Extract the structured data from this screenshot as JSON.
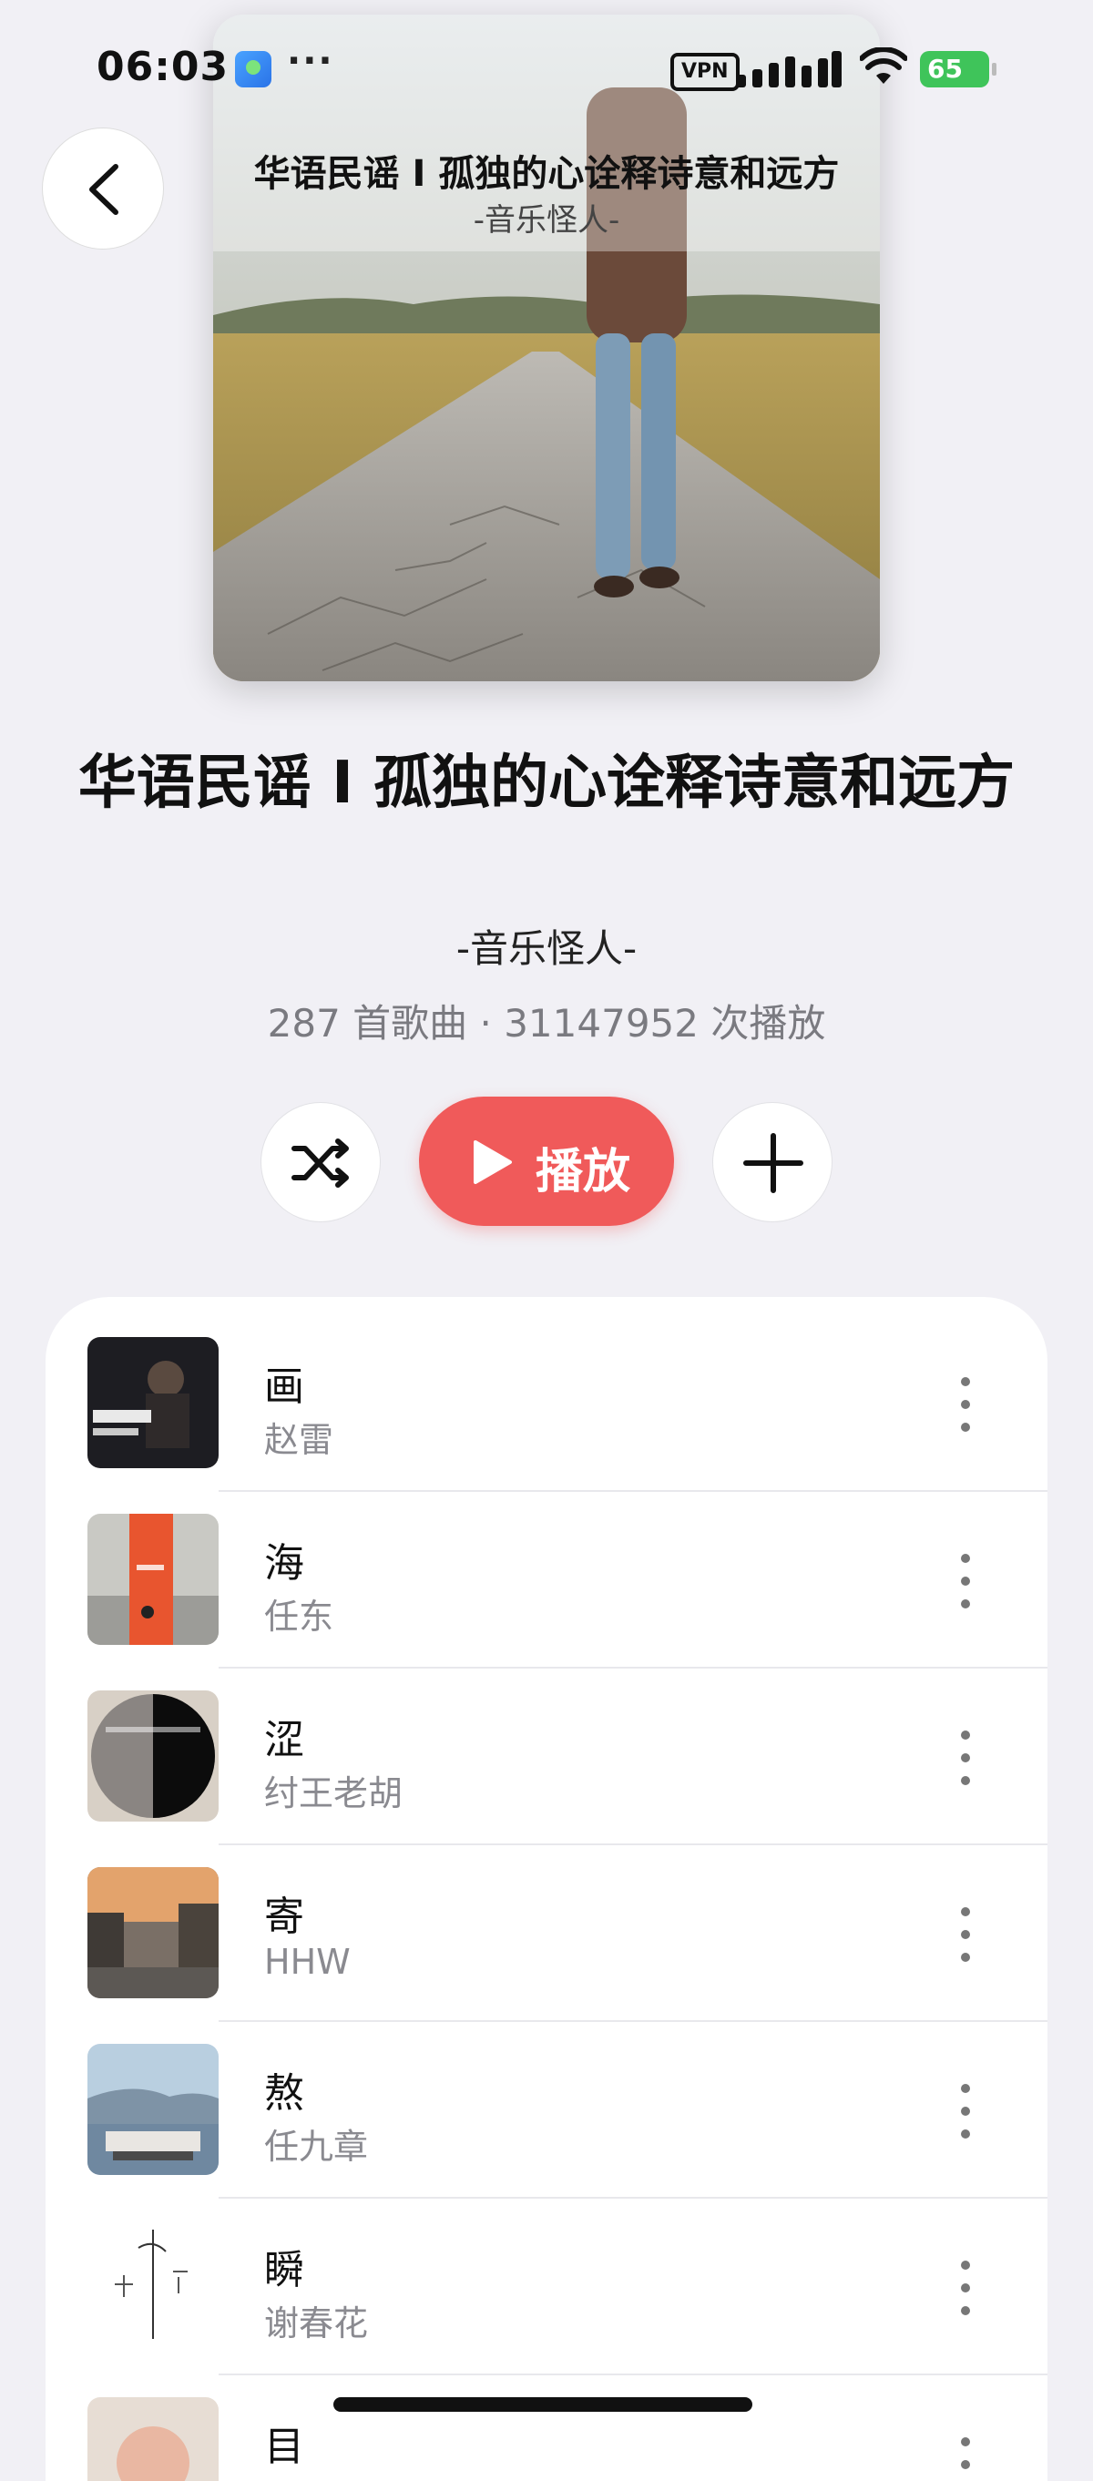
{
  "status_bar": {
    "time": "06:03",
    "more": "···",
    "vpn": "VPN",
    "battery": "65"
  },
  "header": {
    "overlay_title": "华语民谣 I 孤独的心诠释诗意和远方",
    "overlay_subtitle": "-音乐怪人-"
  },
  "playlist": {
    "title": "华语民谣 I 孤独的心诠释诗意和远方",
    "curator": "-音乐怪人-",
    "stats": "287 首歌曲 · 31147952 次播放"
  },
  "actions": {
    "play_label": "播放",
    "shuffle_icon": "shuffle-icon",
    "add_icon": "plus-icon"
  },
  "songs": [
    {
      "title": "画",
      "artist": "赵雷"
    },
    {
      "title": "海",
      "artist": "任东"
    },
    {
      "title": "涩",
      "artist": "纣王老胡"
    },
    {
      "title": "寄",
      "artist": "HHW"
    },
    {
      "title": "熬",
      "artist": "任九章"
    },
    {
      "title": "瞬",
      "artist": "谢春花"
    },
    {
      "title": "目",
      "artist": ""
    }
  ],
  "colors": {
    "accent": "#f05a5a",
    "background": "#f1f0f5"
  }
}
